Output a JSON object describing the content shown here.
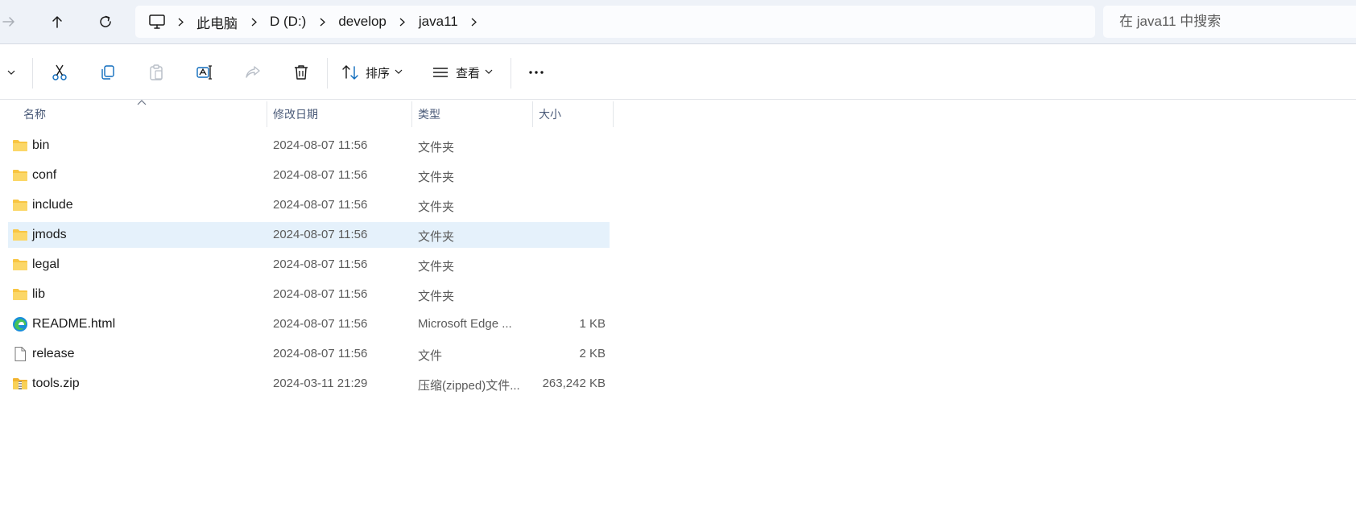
{
  "address_bar": {
    "breadcrumbs": [
      "此电脑",
      "D (D:)",
      "develop",
      "java11"
    ]
  },
  "search": {
    "placeholder": "在 java11 中搜索"
  },
  "command_bar": {
    "sort_label": "排序",
    "view_label": "查看"
  },
  "columns": {
    "name": "名称",
    "modified": "修改日期",
    "type": "类型",
    "size": "大小"
  },
  "files": [
    {
      "name": "bin",
      "modified": "2024-08-07 11:56",
      "type": "文件夹",
      "size": "",
      "icon": "folder-icon"
    },
    {
      "name": "conf",
      "modified": "2024-08-07 11:56",
      "type": "文件夹",
      "size": "",
      "icon": "folder-icon"
    },
    {
      "name": "include",
      "modified": "2024-08-07 11:56",
      "type": "文件夹",
      "size": "",
      "icon": "folder-icon"
    },
    {
      "name": "jmods",
      "modified": "2024-08-07 11:56",
      "type": "文件夹",
      "size": "",
      "icon": "folder-icon",
      "selected": true
    },
    {
      "name": "legal",
      "modified": "2024-08-07 11:56",
      "type": "文件夹",
      "size": "",
      "icon": "folder-icon"
    },
    {
      "name": "lib",
      "modified": "2024-08-07 11:56",
      "type": "文件夹",
      "size": "",
      "icon": "folder-icon"
    },
    {
      "name": "README.html",
      "modified": "2024-08-07 11:56",
      "type": "Microsoft Edge ...",
      "size": "1 KB",
      "icon": "edge-icon"
    },
    {
      "name": "release",
      "modified": "2024-08-07 11:56",
      "type": "文件",
      "size": "2 KB",
      "icon": "file-icon"
    },
    {
      "name": "tools.zip",
      "modified": "2024-03-11 21:29",
      "type": "压缩(zipped)文件...",
      "size": "263,242 KB",
      "icon": "zip-folder-icon"
    }
  ],
  "colors": {
    "accent": "#0067c0",
    "selected_row": "#e5f1fb",
    "folder": "#f8c542",
    "address_bar_bg": "#eef2f8"
  }
}
